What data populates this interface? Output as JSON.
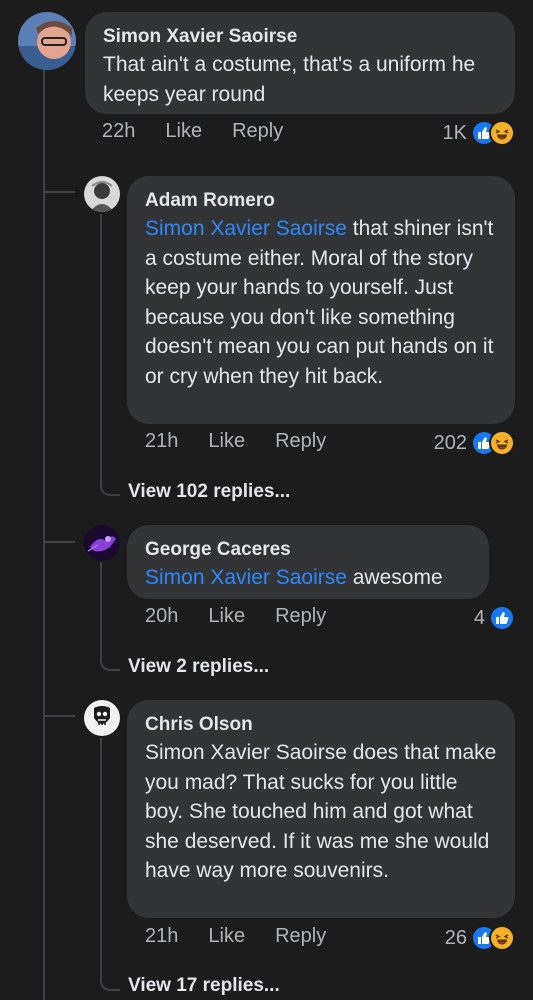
{
  "comments": [
    {
      "author": "Simon Xavier Saoirse",
      "text": "That ain't a costume, that's a uniform he keeps year round",
      "time": "22h",
      "like_label": "Like",
      "reply_label": "Reply",
      "reaction_count": "1K",
      "reactions": [
        "like-icon",
        "haha-icon"
      ]
    },
    {
      "author": "Adam Romero",
      "mention": "Simon Xavier Saoirse",
      "text": " that shiner isn't a costume either. Moral of the story keep your hands to yourself. Just because you don't like something doesn't mean you can put hands on it or cry when they hit back.",
      "time": "21h",
      "like_label": "Like",
      "reply_label": "Reply",
      "reaction_count": "202",
      "reactions": [
        "like-icon",
        "haha-icon"
      ],
      "view_replies": "View 102 replies..."
    },
    {
      "author": "George Caceres",
      "mention": "Simon Xavier Saoirse",
      "text": " awesome",
      "time": "20h",
      "like_label": "Like",
      "reply_label": "Reply",
      "reaction_count": "4",
      "reactions": [
        "like-icon"
      ],
      "view_replies": "View 2 replies..."
    },
    {
      "author": "Chris Olson",
      "text": "Simon Xavier Saoirse does that make you mad? That sucks for you little boy. She touched him and got what she deserved. If it was me she would have way more souvenirs.",
      "time": "21h",
      "like_label": "Like",
      "reply_label": "Reply",
      "reaction_count": "26",
      "reactions": [
        "like-icon",
        "haha-icon"
      ],
      "view_replies": "View 17 replies..."
    }
  ],
  "colors": {
    "background": "#1c1c1d",
    "bubble": "#333435",
    "mention": "#2d88ff",
    "like": "#1877f2",
    "haha": "#f7b125",
    "meta": "#b0b3b8"
  }
}
